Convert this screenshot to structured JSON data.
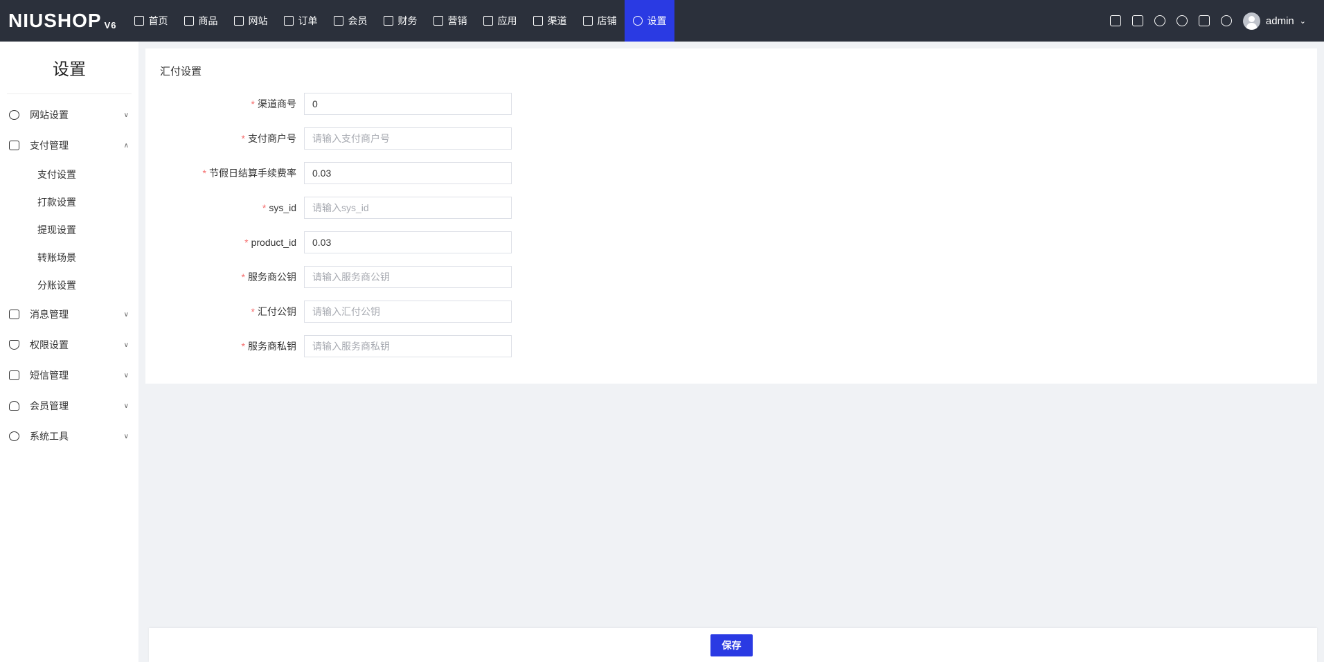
{
  "header": {
    "logo": "NIUSHOP",
    "logo_version": "V6",
    "nav": [
      {
        "label": "首页",
        "icon": "monitor-icon"
      },
      {
        "label": "商品",
        "icon": "box-icon"
      },
      {
        "label": "网站",
        "icon": "website-icon"
      },
      {
        "label": "订单",
        "icon": "clipboard-icon"
      },
      {
        "label": "会员",
        "icon": "member-icon"
      },
      {
        "label": "财务",
        "icon": "finance-icon"
      },
      {
        "label": "营销",
        "icon": "marketing-icon"
      },
      {
        "label": "应用",
        "icon": "apps-icon"
      },
      {
        "label": "渠道",
        "icon": "channel-icon"
      },
      {
        "label": "店铺",
        "icon": "store-icon"
      },
      {
        "label": "设置",
        "icon": "gear-icon",
        "active": true
      }
    ],
    "user": "admin",
    "accent": "#2a3ae3"
  },
  "sidebar": {
    "title": "设置",
    "items": [
      {
        "label": "网站设置",
        "icon": "globe-icon"
      },
      {
        "label": "支付管理",
        "icon": "wallet-icon",
        "expanded": true,
        "children": [
          "支付设置",
          "打款设置",
          "提现设置",
          "转账场景",
          "分账设置"
        ]
      },
      {
        "label": "消息管理",
        "icon": "message-icon"
      },
      {
        "label": "权限设置",
        "icon": "shield-icon"
      },
      {
        "label": "短信管理",
        "icon": "mail-icon"
      },
      {
        "label": "会员管理",
        "icon": "user-gear-icon"
      },
      {
        "label": "系统工具",
        "icon": "tool-icon"
      }
    ]
  },
  "form": {
    "title": "汇付设置",
    "fields": [
      {
        "label": "渠道商号",
        "value": "0",
        "placeholder": ""
      },
      {
        "label": "支付商户号",
        "value": "",
        "placeholder": "请输入支付商户号"
      },
      {
        "label": "节假日结算手续费率",
        "value": "0.03",
        "placeholder": ""
      },
      {
        "label": "sys_id",
        "value": "",
        "placeholder": "请输入sys_id"
      },
      {
        "label": "product_id",
        "value": "0.03",
        "placeholder": ""
      },
      {
        "label": "服务商公钥",
        "value": "",
        "placeholder": "请输入服务商公钥"
      },
      {
        "label": "汇付公钥",
        "value": "",
        "placeholder": "请输入汇付公钥"
      },
      {
        "label": "服务商私钥",
        "value": "",
        "placeholder": "请输入服务商私钥"
      }
    ],
    "save_label": "保存"
  }
}
